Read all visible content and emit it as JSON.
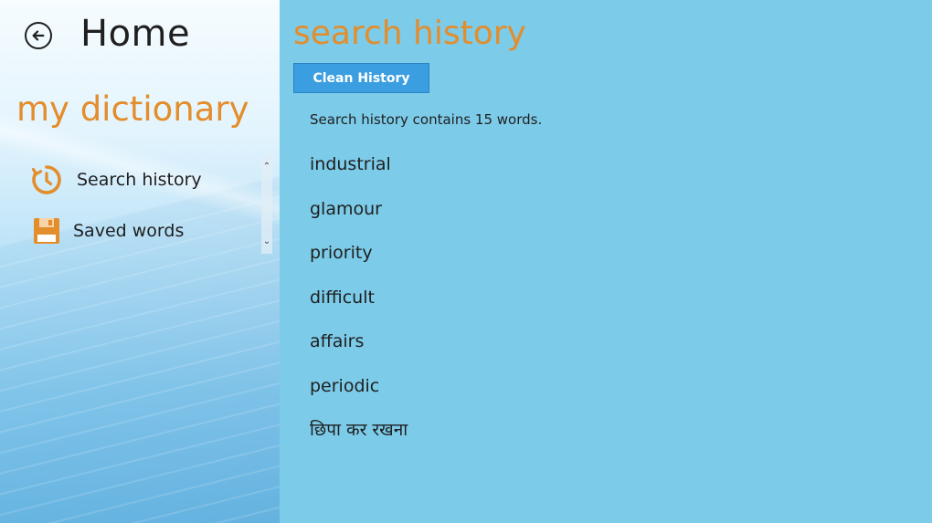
{
  "nav": {
    "home_title": "Home",
    "app_title": "my dictionary",
    "items": [
      {
        "label": "Search history",
        "icon": "history-clock-icon"
      },
      {
        "label": "Saved words",
        "icon": "floppy-disk-icon"
      }
    ]
  },
  "main": {
    "title": "search history",
    "clean_button": "Clean History",
    "count_text": "Search history contains 15 words.",
    "words": [
      "industrial",
      "glamour",
      "priority",
      "difficult",
      "affairs",
      "periodic",
      "छिपा कर रखना"
    ]
  },
  "colors": {
    "accent_orange": "#e38d2c",
    "content_bg": "#7ccbe9",
    "button_bg": "#3b9ee0"
  }
}
